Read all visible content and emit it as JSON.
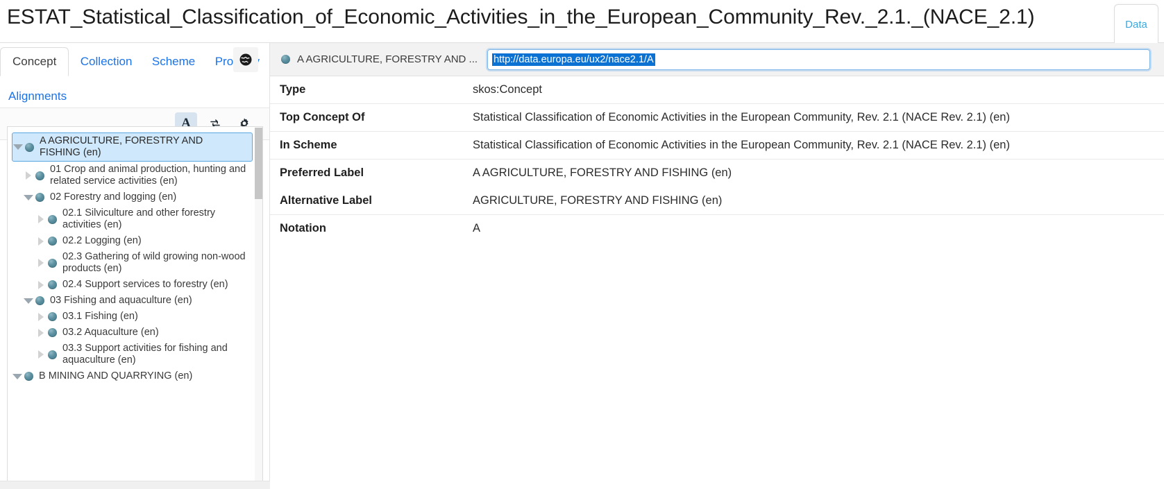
{
  "window": {
    "title": "ESTAT_Statistical_Classification_of_Economic_Activities_in_the_European_Community_Rev._2.1._(NACE_2.1)",
    "data_tab_label": "Data"
  },
  "left_panel": {
    "tabs": [
      {
        "label": "Concept",
        "active": true
      },
      {
        "label": "Collection",
        "active": false
      },
      {
        "label": "Scheme",
        "active": false
      },
      {
        "label": "Property",
        "active": false
      },
      {
        "label": "Alignments",
        "active": false
      }
    ],
    "globe_icon": "globe-icon",
    "toolbar": {
      "alphabetical_label": "A",
      "refresh_icon": "refresh-icon",
      "settings_icon": "gear-icon"
    },
    "tree": [
      {
        "label": "A AGRICULTURE, FORESTRY AND FISHING (en)",
        "depth": 0,
        "state": "expanded",
        "selected": true
      },
      {
        "label": "01 Crop and animal production, hunting and related service activities (en)",
        "depth": 1,
        "state": "collapsed",
        "selected": false
      },
      {
        "label": "02 Forestry and logging (en)",
        "depth": 1,
        "state": "expanded",
        "selected": false
      },
      {
        "label": "02.1 Silviculture and other forestry activities (en)",
        "depth": 2,
        "state": "collapsed",
        "selected": false
      },
      {
        "label": "02.2 Logging (en)",
        "depth": 2,
        "state": "collapsed",
        "selected": false
      },
      {
        "label": "02.3 Gathering of wild growing non-wood products (en)",
        "depth": 2,
        "state": "collapsed",
        "selected": false
      },
      {
        "label": "02.4 Support services to forestry (en)",
        "depth": 2,
        "state": "collapsed",
        "selected": false
      },
      {
        "label": "03 Fishing and aquaculture (en)",
        "depth": 1,
        "state": "expanded",
        "selected": false
      },
      {
        "label": "03.1 Fishing (en)",
        "depth": 2,
        "state": "collapsed",
        "selected": false
      },
      {
        "label": "03.2 Aquaculture (en)",
        "depth": 2,
        "state": "collapsed",
        "selected": false
      },
      {
        "label": "03.3 Support activities for fishing and aquaculture (en)",
        "depth": 2,
        "state": "collapsed",
        "selected": false
      },
      {
        "label": "B MINING AND QUARRYING (en)",
        "depth": 0,
        "state": "expanded",
        "selected": false
      }
    ]
  },
  "right_panel": {
    "concept_name": "A AGRICULTURE, FORESTRY AND ...",
    "uri_value": "http://data.europa.eu/ux2/nace2.1/A",
    "uri_selected": true,
    "properties": [
      {
        "key": "Type",
        "value": "skos:Concept",
        "divider": true
      },
      {
        "key": "Top Concept Of",
        "value": "Statistical Classification of Economic Activities in the European Community, Rev. 2.1 (NACE Rev. 2.1) (en)",
        "divider": true
      },
      {
        "key": "In Scheme",
        "value": "Statistical Classification of Economic Activities in the European Community, Rev. 2.1 (NACE Rev. 2.1) (en)",
        "divider": true
      },
      {
        "key": "Preferred Label",
        "value": "A AGRICULTURE, FORESTRY AND FISHING  (en)",
        "divider": false
      },
      {
        "key": "Alternative Label",
        "value": "AGRICULTURE, FORESTRY AND FISHING  (en)",
        "divider": true
      },
      {
        "key": "Notation",
        "value": "A",
        "divider": false
      }
    ]
  },
  "colors": {
    "link_blue": "#1a73e8",
    "tab_accent": "#3aa8e0",
    "selection_blue": "#0b72d4",
    "tree_selected_bg": "#cfe8fb",
    "bullet_teal": "#3e7a8b"
  }
}
